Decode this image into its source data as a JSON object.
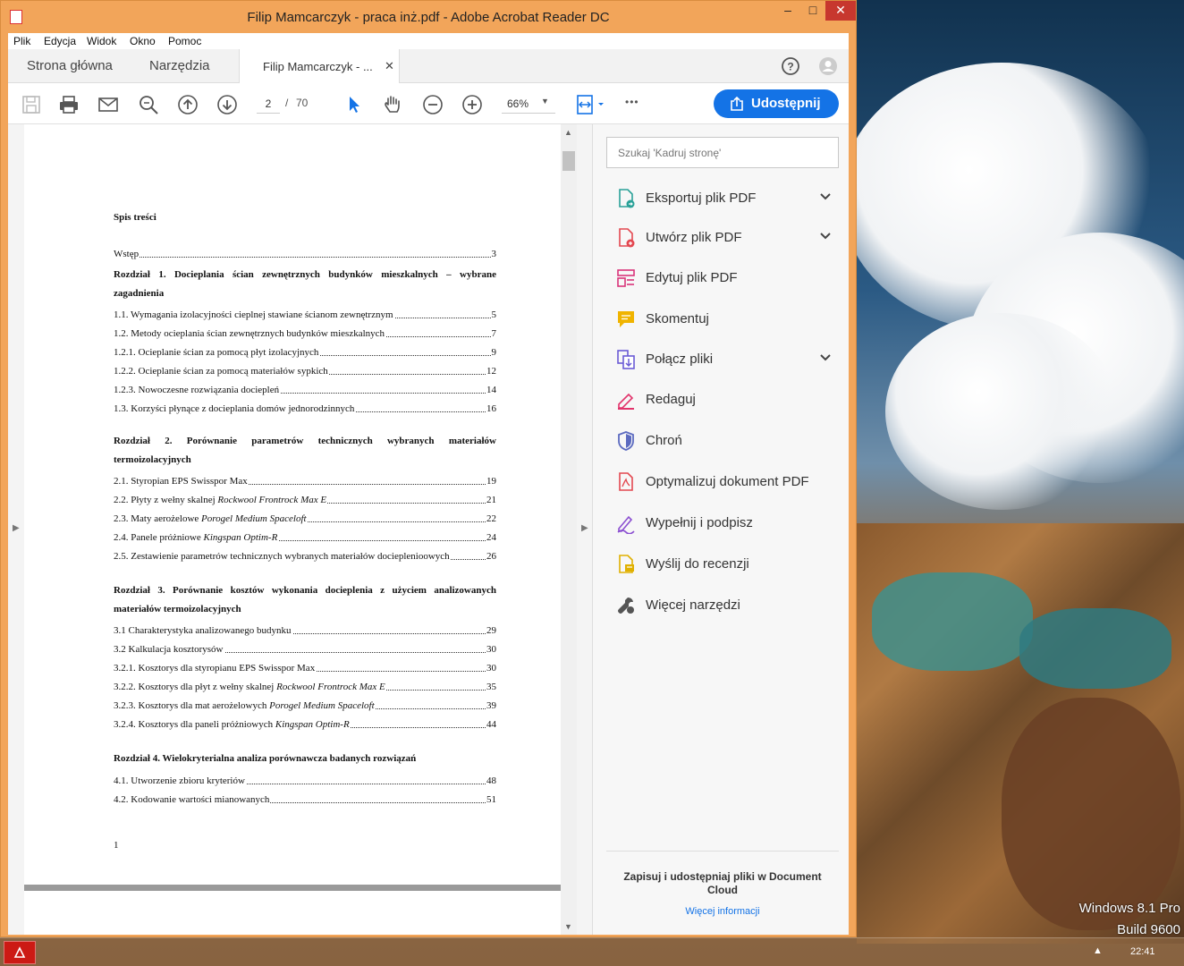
{
  "window": {
    "title": "Filip Mamcarczyk - praca inż.pdf - Adobe Acrobat Reader DC",
    "min": "–",
    "max": "□",
    "close": "✕"
  },
  "menu": [
    "Plik",
    "Edycja",
    "Widok",
    "Okno",
    "Pomoc"
  ],
  "tabs": {
    "home": "Strona główna",
    "tools": "Narzędzia",
    "document": "Filip Mamcarczyk - ...",
    "close": "✕"
  },
  "toolbar": {
    "page_current": "2",
    "page_sep": "/",
    "page_total": "70",
    "zoom": "66%",
    "share_label": "Udostępnij",
    "more": "•••"
  },
  "document": {
    "toc_title": "Spis treści",
    "footer_page": "1",
    "entries": [
      {
        "text": "Wstęp",
        "page": "3"
      },
      {
        "chapter": "Rozdział 1. Docieplania ścian zewnętrznych budynków mieszkalnych – wybrane zagadnienia"
      },
      {
        "text": "1.1. Wymagania izolacyjności cieplnej stawiane ścianom zewnętrznym",
        "page": "5"
      },
      {
        "text": "1.2. Metody ocieplania ścian zewnętrznych budynków mieszkalnych",
        "page": "7"
      },
      {
        "text": "1.2.1. Ocieplanie ścian za pomocą płyt izolacyjnych",
        "page": "9"
      },
      {
        "text": "1.2.2. Ocieplanie ścian za pomocą materiałów sypkich",
        "page": "12"
      },
      {
        "text": "1.2.3. Nowoczesne rozwiązania dociepleń",
        "page": "14"
      },
      {
        "text": "1.3. Korzyści płynące z docieplania domów jednorodzinnych",
        "page": "16"
      },
      {
        "chapter": "Rozdział 2. Porównanie parametrów technicznych wybranych materiałów termoizolacyjnych"
      },
      {
        "text": "2.1. Styropian EPS Swisspor Max",
        "page": "19"
      },
      {
        "text": "2.2. Płyty z wełny skalnej ",
        "italic": "Rockwool Frontrock Max E",
        "page": "21"
      },
      {
        "text": "2.3. Maty aerożelowe ",
        "italic": "Porogel Medium Spaceloft",
        "page": "22"
      },
      {
        "text": "2.4. Panele próżniowe ",
        "italic": "Kingspan Optim-R",
        "page": "24"
      },
      {
        "text": "2.5. Zestawienie parametrów technicznych wybranych materiałów docieplenioowych",
        "page": "26"
      },
      {
        "chapter": "Rozdział 3. Porównanie kosztów wykonania docieplenia z użyciem analizowanych materiałów termoizolacyjnych"
      },
      {
        "text": "3.1 Charakterystyka analizowanego budynku",
        "page": "29"
      },
      {
        "text": "3.2 Kalkulacja kosztorysów",
        "page": "30"
      },
      {
        "text": "3.2.1. Kosztorys dla styropianu EPS Swisspor Max",
        "page": "30"
      },
      {
        "text": "3.2.2. Kosztorys dla płyt z wełny skalnej ",
        "italic": "Rockwool Frontrock Max E",
        "page": "35"
      },
      {
        "text": "3.2.3. Kosztorys dla mat aerożelowych ",
        "italic": "Porogel Medium Spaceloft",
        "page": "39"
      },
      {
        "text": "3.2.4. Kosztorys dla paneli próżniowych ",
        "italic": "Kingspan Optim-R",
        "page": "44"
      },
      {
        "chapter": "Rozdział 4. Wielokryterialna analiza porównawcza badanych rozwiązań"
      },
      {
        "text": "4.1. Utworzenie zbioru kryteriów",
        "page": "48"
      },
      {
        "text": "4.2. Kodowanie wartości mianowanych",
        "page": "51"
      }
    ]
  },
  "tools_pane": {
    "search_placeholder": "Szukaj 'Kadruj stronę'",
    "items": [
      {
        "label": "Eksportuj plik PDF",
        "icon": "export-pdf-icon",
        "color": "#2aa198"
      },
      {
        "label": "Utwórz plik PDF",
        "icon": "create-pdf-icon",
        "color": "#e34850"
      },
      {
        "label": "Edytuj plik PDF",
        "icon": "edit-pdf-icon",
        "color": "#d9347a"
      },
      {
        "label": "Skomentuj",
        "icon": "comment-icon",
        "color": "#f0b400"
      },
      {
        "label": "Połącz pliki",
        "icon": "combine-files-icon",
        "color": "#6b5bd6"
      },
      {
        "label": "Redaguj",
        "icon": "redact-icon",
        "color": "#e2336b"
      },
      {
        "label": "Chroń",
        "icon": "protect-icon",
        "color": "#5c6bc0"
      },
      {
        "label": "Optymalizuj dokument PDF",
        "icon": "optimize-pdf-icon",
        "color": "#e34850"
      },
      {
        "label": "Wypełnij i podpisz",
        "icon": "fill-sign-icon",
        "color": "#8b4fd1"
      },
      {
        "label": "Wyślij do recenzji",
        "icon": "send-review-icon",
        "color": "#e0b000"
      },
      {
        "label": "Więcej narzędzi",
        "icon": "more-tools-icon",
        "color": "#555555"
      }
    ],
    "cloud_text": "Zapisuj i udostępniaj pliki w Document Cloud",
    "more_info": "Więcej informacji"
  },
  "desktop": {
    "os_line1": "Windows 8.1 Pro",
    "os_line2": "Build 9600",
    "clock": "22:41",
    "tray": "▲"
  }
}
